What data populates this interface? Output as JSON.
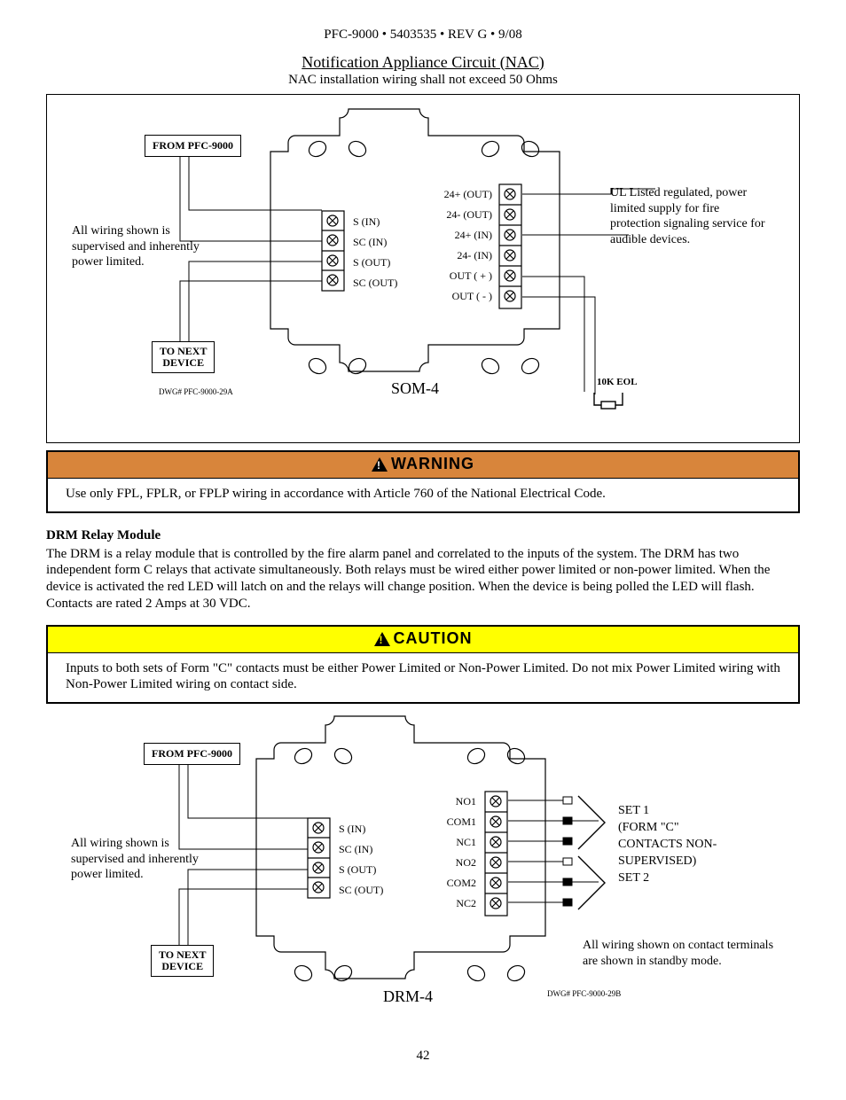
{
  "header": "PFC-9000 • 5403535 • REV G • 9/08",
  "nac": {
    "title": "Notification Appliance Circuit (NAC)",
    "subtitle": "NAC installation wiring shall not exceed 50 Ohms",
    "from_box": "FROM PFC-9000",
    "left_note": "All wiring shown is supervised and inherently power limited.",
    "to_box_l1": "TO NEXT",
    "to_box_l2": "DEVICE",
    "dwg": "DWG# PFC-9000-29A",
    "dev_name": "SOM-4",
    "eol": "10K EOL",
    "right_note": "UL Listed regulated, power limited supply for fire protection signaling service for audible devices.",
    "left_terms": {
      "t1": "S (IN)",
      "t2": "SC (IN)",
      "t3": "S (OUT)",
      "t4": "SC (OUT)"
    },
    "right_terms": {
      "t1": "24+ (OUT)",
      "t2": "24- (OUT)",
      "t3": "24+ (IN)",
      "t4": "24- (IN)",
      "t5": "OUT ( + )",
      "t6": "OUT ( - )"
    }
  },
  "warning": {
    "label": "WARNING",
    "body": "Use only FPL, FPLR, or FPLP wiring in accordance with Article 760 of the National Electrical Code."
  },
  "drm_section": {
    "title": "DRM Relay Module",
    "body": "The DRM is a relay module that is controlled by the fire alarm panel and correlated to the inputs of the system. The DRM has two independent form C relays that activate simultaneously. Both relays must be wired either power limited or non-power limited. When the device is activated the red LED will latch on and the relays will change position. When the device is being polled the LED will flash. Contacts are rated 2 Amps at 30 VDC."
  },
  "caution": {
    "label": "CAUTION",
    "body": "Inputs to both sets of Form \"C\" contacts must be either Power Limited or Non-Power Limited.  Do not mix Power Limited wiring with Non-Power Limited wiring on contact side."
  },
  "drm": {
    "from_box": "FROM PFC-9000",
    "left_note": "All wiring shown is supervised and inherently power limited.",
    "to_box_l1": "TO NEXT",
    "to_box_l2": "DEVICE",
    "dev_name": "DRM-4",
    "dwg": "DWG# PFC-9000-29B",
    "right_note_l1": "SET 1",
    "right_note_l2": "(FORM \"C\"",
    "right_note_l3": "CONTACTS NON-",
    "right_note_l4": "SUPERVISED)",
    "right_note_l5": "SET 2",
    "standby_note": "All wiring shown on contact terminals are shown in standby mode.",
    "left_terms": {
      "t1": "S (IN)",
      "t2": "SC (IN)",
      "t3": "S (OUT)",
      "t4": "SC (OUT)"
    },
    "right_terms": {
      "t1": "NO1",
      "t2": "COM1",
      "t3": "NC1",
      "t4": "NO2",
      "t5": "COM2",
      "t6": "NC2"
    }
  },
  "page_number": "42"
}
